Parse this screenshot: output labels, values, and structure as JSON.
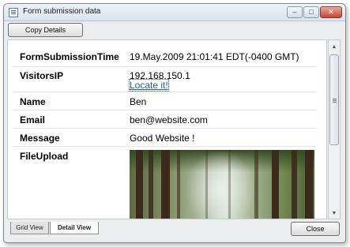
{
  "window": {
    "title": "Form submission data",
    "caption_buttons": {
      "minimize": "–",
      "maximize": "□",
      "close": "✕"
    }
  },
  "toolbar": {
    "copy_label": "Copy Details"
  },
  "details": {
    "form_submission_time": {
      "key": "FormSubmissionTime",
      "value": "19.May.2009 21:01:41 EDT(-0400 GMT)"
    },
    "visitors_ip": {
      "key": "VisitorsIP",
      "value": "192.168.150.1",
      "link": "Locate it!"
    },
    "name": {
      "key": "Name",
      "value": "Ben"
    },
    "email": {
      "key": "Email",
      "value": "ben@website.com"
    },
    "message": {
      "key": "Message",
      "value": "Good Website !"
    },
    "file_upload": {
      "key": "FileUpload",
      "image": "forest-photo"
    }
  },
  "scrollbar": {
    "up": "▲",
    "down": "▼"
  },
  "tabs": {
    "grid": "Grid View",
    "detail": "Detail View"
  },
  "footer": {
    "close_label": "Close"
  },
  "colors": {
    "link": "#1f5fb0",
    "close_caption": "#c8452f"
  }
}
